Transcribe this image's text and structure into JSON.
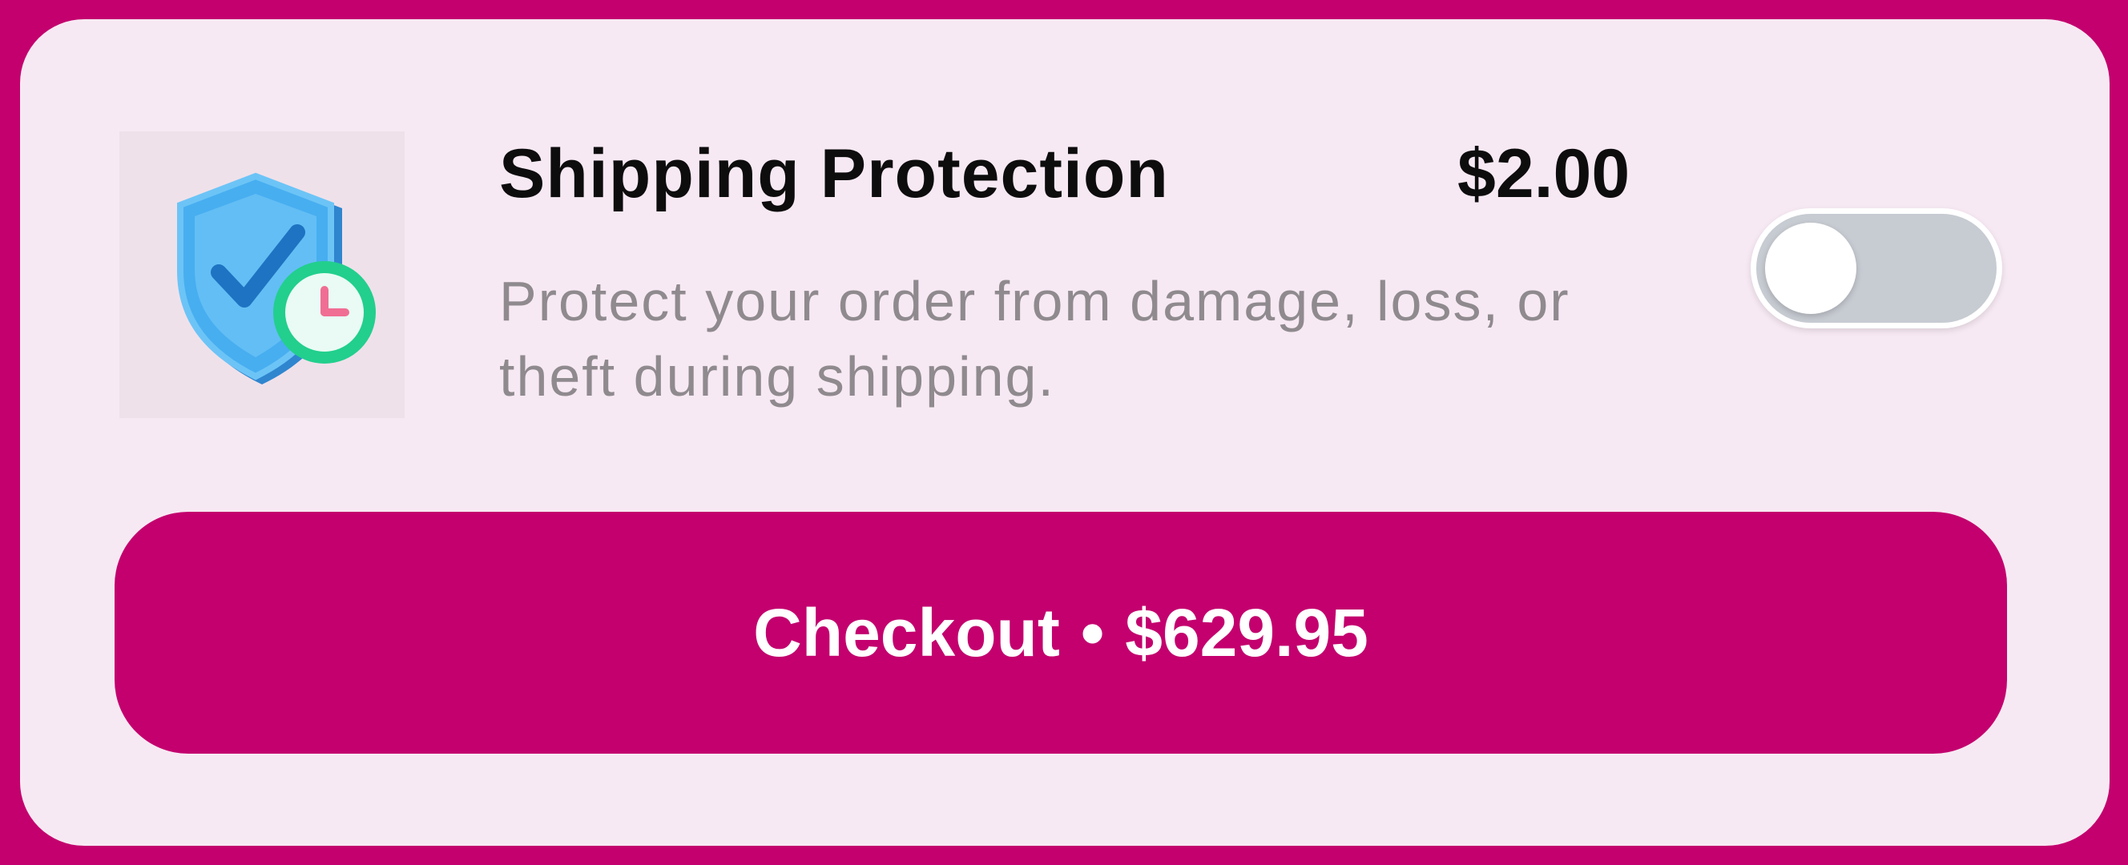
{
  "protection": {
    "title": "Shipping Protection",
    "price": "$2.00",
    "description": "Protect your order from damage, loss, or theft during shipping.",
    "enabled": false,
    "image_icon": "shield-check-clock-icon"
  },
  "checkout": {
    "label": "Checkout",
    "separator": "•",
    "total": "$629.95"
  },
  "colors": {
    "brand": "#c3006e",
    "card_background": "#f7e9f3",
    "toggle_off": "#c7cbd2",
    "title_text": "#0d0d0d",
    "description_text": "#8f8a8e",
    "shield_blue": "#3aa3ec",
    "clock_green": "#22cf8d",
    "clock_hands": "#f06e93"
  }
}
